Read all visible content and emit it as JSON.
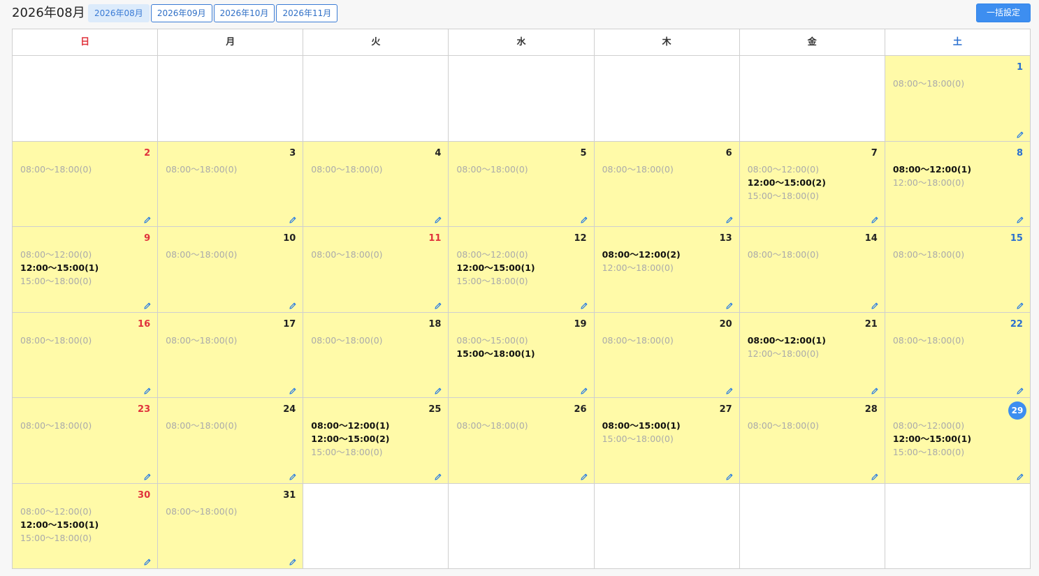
{
  "header": {
    "title": "2026年08月",
    "tabs": [
      "2026年08月",
      "2026年09月",
      "2026年10月",
      "2026年11月"
    ],
    "active_tab": 0,
    "bulk_button": "一括設定"
  },
  "colors": {
    "accent": "#3d8ef0",
    "active_day_bg": "#fffaa8",
    "sunday": "#e0323c",
    "saturday": "#2a6fd0"
  },
  "weekdays": [
    "日",
    "月",
    "火",
    "水",
    "木",
    "金",
    "土"
  ],
  "edit_icon": "pencil-icon",
  "today": 29,
  "weeks": [
    [
      null,
      null,
      null,
      null,
      null,
      null,
      {
        "day": "1",
        "color": "blue",
        "slots": [
          {
            "text": "08:00〜18:00(0)",
            "booked": false
          }
        ]
      }
    ],
    [
      {
        "day": "2",
        "color": "red",
        "slots": [
          {
            "text": "08:00〜18:00(0)",
            "booked": false
          }
        ]
      },
      {
        "day": "3",
        "color": "",
        "slots": [
          {
            "text": "08:00〜18:00(0)",
            "booked": false
          }
        ]
      },
      {
        "day": "4",
        "color": "",
        "slots": [
          {
            "text": "08:00〜18:00(0)",
            "booked": false
          }
        ]
      },
      {
        "day": "5",
        "color": "",
        "slots": [
          {
            "text": "08:00〜18:00(0)",
            "booked": false
          }
        ]
      },
      {
        "day": "6",
        "color": "",
        "slots": [
          {
            "text": "08:00〜18:00(0)",
            "booked": false
          }
        ]
      },
      {
        "day": "7",
        "color": "",
        "slots": [
          {
            "text": "08:00〜12:00(0)",
            "booked": false
          },
          {
            "text": "12:00〜15:00(2)",
            "booked": true
          },
          {
            "text": "15:00〜18:00(0)",
            "booked": false
          }
        ]
      },
      {
        "day": "8",
        "color": "blue",
        "slots": [
          {
            "text": "08:00〜12:00(1)",
            "booked": true
          },
          {
            "text": "12:00〜18:00(0)",
            "booked": false
          }
        ]
      }
    ],
    [
      {
        "day": "9",
        "color": "red",
        "slots": [
          {
            "text": "08:00〜12:00(0)",
            "booked": false
          },
          {
            "text": "12:00〜15:00(1)",
            "booked": true
          },
          {
            "text": "15:00〜18:00(0)",
            "booked": false
          }
        ]
      },
      {
        "day": "10",
        "color": "",
        "slots": [
          {
            "text": "08:00〜18:00(0)",
            "booked": false
          }
        ]
      },
      {
        "day": "11",
        "color": "red",
        "slots": [
          {
            "text": "08:00〜18:00(0)",
            "booked": false
          }
        ]
      },
      {
        "day": "12",
        "color": "",
        "slots": [
          {
            "text": "08:00〜12:00(0)",
            "booked": false
          },
          {
            "text": "12:00〜15:00(1)",
            "booked": true
          },
          {
            "text": "15:00〜18:00(0)",
            "booked": false
          }
        ]
      },
      {
        "day": "13",
        "color": "",
        "slots": [
          {
            "text": "08:00〜12:00(2)",
            "booked": true
          },
          {
            "text": "12:00〜18:00(0)",
            "booked": false
          }
        ]
      },
      {
        "day": "14",
        "color": "",
        "slots": [
          {
            "text": "08:00〜18:00(0)",
            "booked": false
          }
        ]
      },
      {
        "day": "15",
        "color": "blue",
        "slots": [
          {
            "text": "08:00〜18:00(0)",
            "booked": false
          }
        ]
      }
    ],
    [
      {
        "day": "16",
        "color": "red",
        "slots": [
          {
            "text": "08:00〜18:00(0)",
            "booked": false
          }
        ]
      },
      {
        "day": "17",
        "color": "",
        "slots": [
          {
            "text": "08:00〜18:00(0)",
            "booked": false
          }
        ]
      },
      {
        "day": "18",
        "color": "",
        "slots": [
          {
            "text": "08:00〜18:00(0)",
            "booked": false
          }
        ]
      },
      {
        "day": "19",
        "color": "",
        "slots": [
          {
            "text": "08:00〜15:00(0)",
            "booked": false
          },
          {
            "text": "15:00〜18:00(1)",
            "booked": true
          }
        ]
      },
      {
        "day": "20",
        "color": "",
        "slots": [
          {
            "text": "08:00〜18:00(0)",
            "booked": false
          }
        ]
      },
      {
        "day": "21",
        "color": "",
        "slots": [
          {
            "text": "08:00〜12:00(1)",
            "booked": true
          },
          {
            "text": "12:00〜18:00(0)",
            "booked": false
          }
        ]
      },
      {
        "day": "22",
        "color": "blue",
        "slots": [
          {
            "text": "08:00〜18:00(0)",
            "booked": false
          }
        ]
      }
    ],
    [
      {
        "day": "23",
        "color": "red",
        "slots": [
          {
            "text": "08:00〜18:00(0)",
            "booked": false
          }
        ]
      },
      {
        "day": "24",
        "color": "",
        "slots": [
          {
            "text": "08:00〜18:00(0)",
            "booked": false
          }
        ]
      },
      {
        "day": "25",
        "color": "",
        "slots": [
          {
            "text": "08:00〜12:00(1)",
            "booked": true
          },
          {
            "text": "12:00〜15:00(2)",
            "booked": true
          },
          {
            "text": "15:00〜18:00(0)",
            "booked": false
          }
        ]
      },
      {
        "day": "26",
        "color": "",
        "slots": [
          {
            "text": "08:00〜18:00(0)",
            "booked": false
          }
        ]
      },
      {
        "day": "27",
        "color": "",
        "slots": [
          {
            "text": "08:00〜15:00(1)",
            "booked": true
          },
          {
            "text": "15:00〜18:00(0)",
            "booked": false
          }
        ]
      },
      {
        "day": "28",
        "color": "",
        "slots": [
          {
            "text": "08:00〜18:00(0)",
            "booked": false
          }
        ]
      },
      {
        "day": "29",
        "color": "today",
        "slots": [
          {
            "text": "08:00〜12:00(0)",
            "booked": false
          },
          {
            "text": "12:00〜15:00(1)",
            "booked": true
          },
          {
            "text": "15:00〜18:00(0)",
            "booked": false
          }
        ]
      }
    ],
    [
      {
        "day": "30",
        "color": "red",
        "slots": [
          {
            "text": "08:00〜12:00(0)",
            "booked": false
          },
          {
            "text": "12:00〜15:00(1)",
            "booked": true
          },
          {
            "text": "15:00〜18:00(0)",
            "booked": false
          }
        ]
      },
      {
        "day": "31",
        "color": "",
        "slots": [
          {
            "text": "08:00〜18:00(0)",
            "booked": false
          }
        ]
      },
      null,
      null,
      null,
      null,
      null
    ]
  ]
}
